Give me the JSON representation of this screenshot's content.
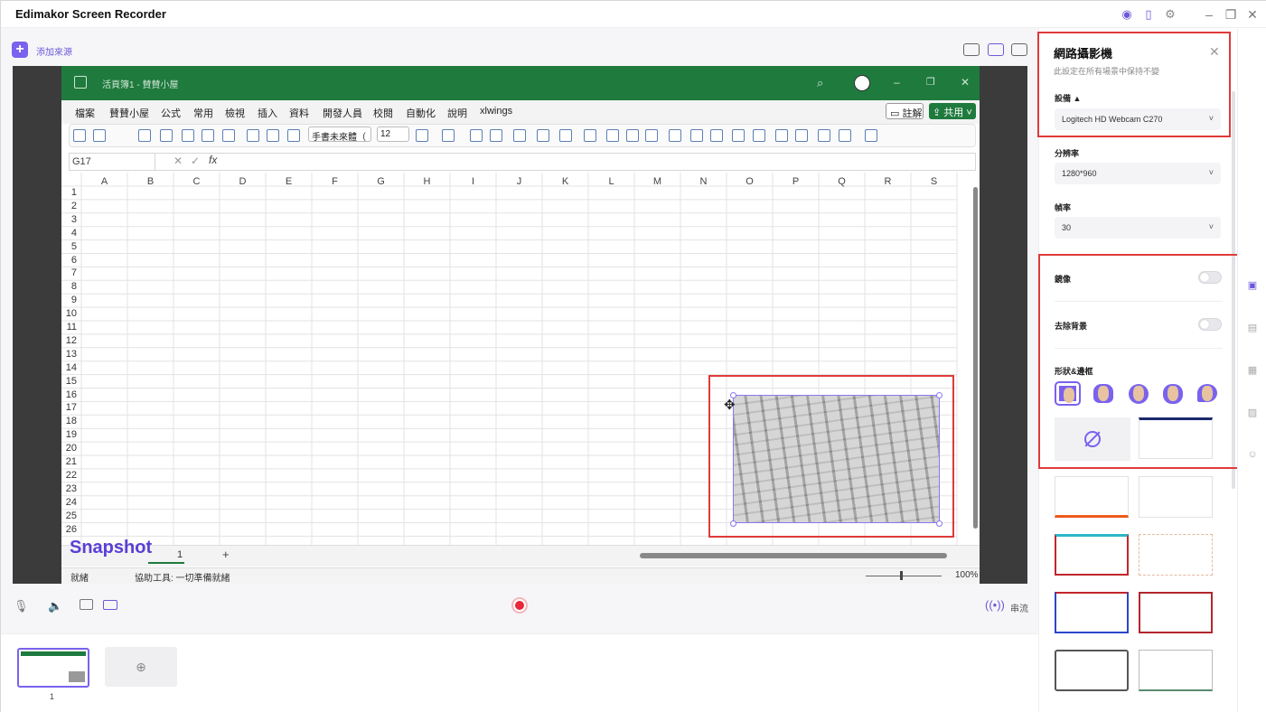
{
  "app": {
    "title": "Edimakor Screen Recorder",
    "add_source_label": "添加來源"
  },
  "excel": {
    "title": "活頁簿1 - 賛賛小屋",
    "menu": [
      "檔案",
      "賛賛小屋",
      "公式",
      "常用",
      "檢視",
      "插入",
      "資料",
      "開發人員",
      "校閱",
      "自動化",
      "說明",
      "xlwings"
    ],
    "comment_btn": "註解",
    "share_btn": "共用",
    "font_name": "手書未來體（",
    "font_size": "12",
    "namebox": "G17",
    "columns": [
      "A",
      "B",
      "C",
      "D",
      "E",
      "F",
      "G",
      "H",
      "I",
      "J",
      "K",
      "L",
      "M",
      "N",
      "O",
      "P",
      "Q",
      "R",
      "S"
    ],
    "rows": [
      "1",
      "2",
      "3",
      "4",
      "5",
      "6",
      "7",
      "8",
      "9",
      "10",
      "11",
      "12",
      "13",
      "14",
      "15",
      "16",
      "17",
      "18",
      "19",
      "20",
      "21",
      "22",
      "23",
      "24",
      "25",
      "26"
    ],
    "sheet_tab": "1",
    "add_sheet": "+",
    "status_ready": "就緒",
    "status_access": "協助工具: 一切準備就緒",
    "zoom": "100%"
  },
  "overlay": {
    "snapshot": "Snapshot"
  },
  "bottom": {
    "stream_label": "串流",
    "scene_number": "1"
  },
  "panel": {
    "title": "網路攝影機",
    "subtitle": "此設定在所有場景中保持不變",
    "device_label": "設備",
    "device_value": "Logitech HD Webcam C270",
    "resolution_label": "分辨率",
    "resolution_value": "1280*960",
    "framerate_label": "幀率",
    "framerate_value": "30",
    "mirror_label": "鏡像",
    "remove_bg_label": "去除背景",
    "shape_label": "形狀&邊框",
    "accent": "#7a62ee",
    "highlight": "#e03a3a"
  }
}
